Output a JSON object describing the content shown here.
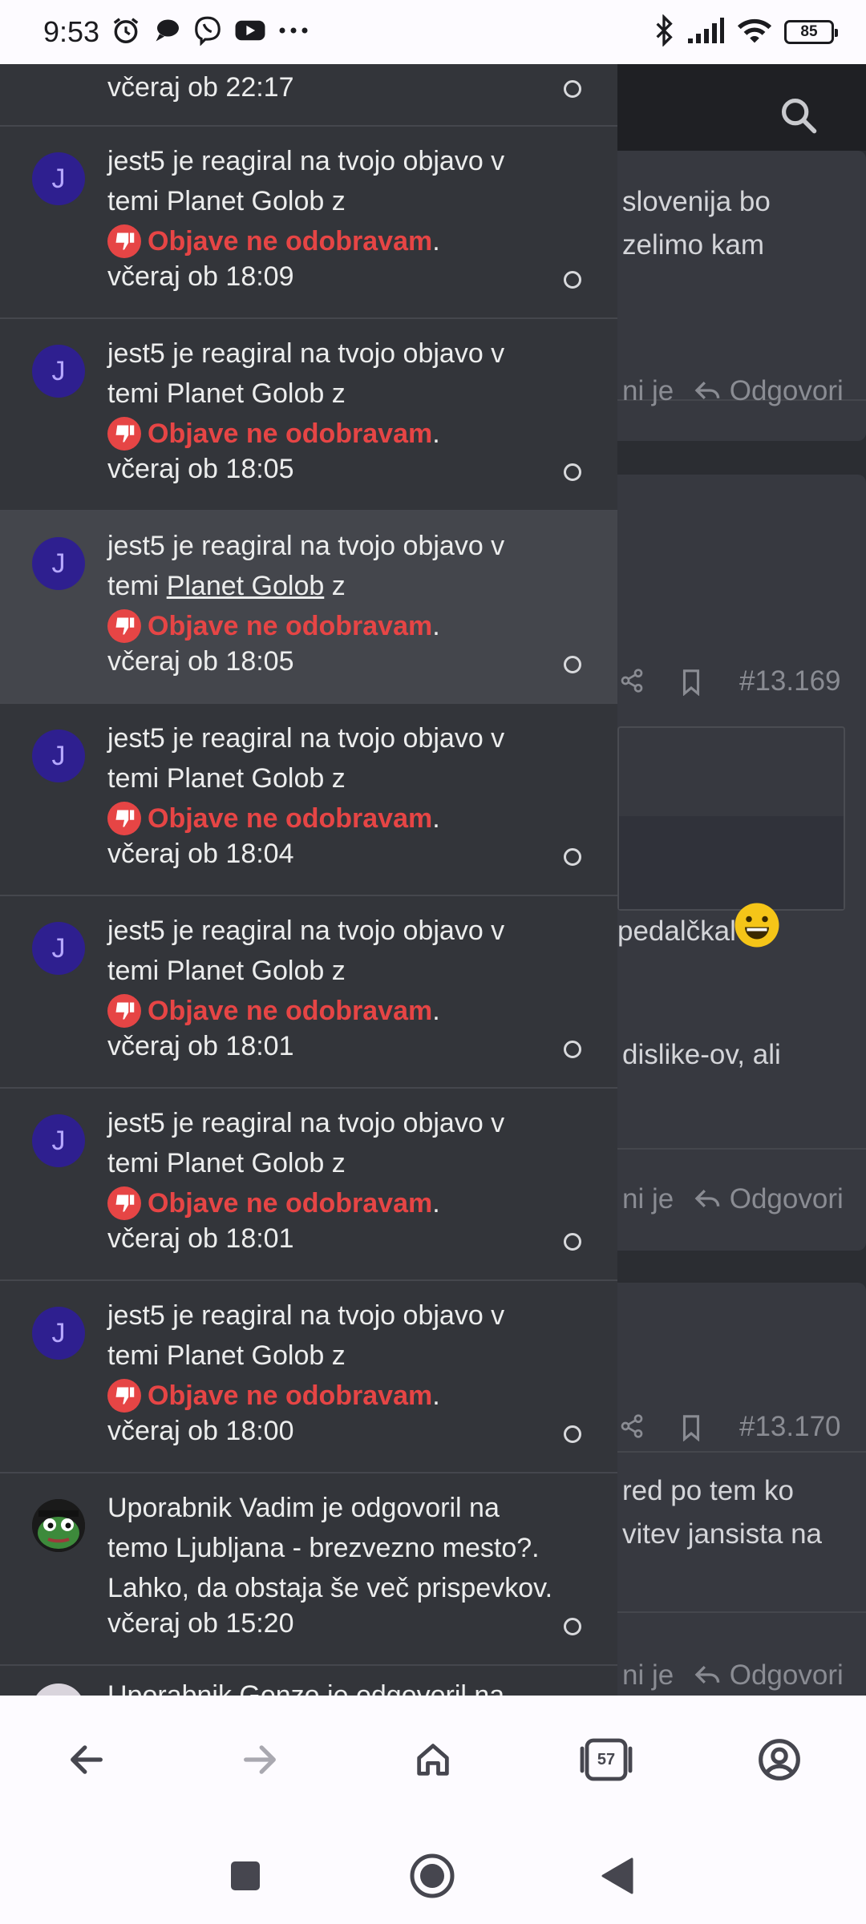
{
  "status_bar": {
    "time": "9:53",
    "battery": "85",
    "icons": [
      "alarm-icon",
      "chat-icon",
      "viber-icon",
      "youtube-icon",
      "more-icon",
      "bluetooth-icon",
      "signal-icon",
      "wifi-icon",
      "battery-icon"
    ]
  },
  "background_page": {
    "snippet_1": [
      "slovenija bo",
      "zelimo kam"
    ],
    "like_partial": "ni je",
    "reply_label": "Odgovori",
    "post_number_1": "#13.169",
    "quote_partial": "pedalčkal",
    "text_partial_2": "dislike-ov, ali",
    "post_number_2": "#13.170",
    "snippet_3": [
      "red po tem ko",
      "vitev jansista na"
    ]
  },
  "notifications": [
    {
      "time": "včeraj ob 22:17"
    },
    {
      "avatar": "J",
      "line1": "jest5 je reagiral na tvojo objavo v",
      "line2_prefix": "temi ",
      "thread": "Planet Golob",
      "line2_suffix": " z",
      "reaction": "Objave ne odobravam",
      "period": ".",
      "time": "včeraj ob 18:09"
    },
    {
      "avatar": "J",
      "line1": "jest5 je reagiral na tvojo objavo v",
      "line2_prefix": "temi ",
      "thread": "Planet Golob",
      "line2_suffix": " z",
      "reaction": "Objave ne odobravam",
      "period": ".",
      "time": "včeraj ob 18:05"
    },
    {
      "avatar": "J",
      "line1": "jest5 je reagiral na tvojo objavo v",
      "line2_prefix": "temi ",
      "thread": "Planet Golob",
      "line2_suffix": " z",
      "reaction": "Objave ne odobravam",
      "period": ".",
      "time": "včeraj ob 18:05"
    },
    {
      "avatar": "J",
      "line1": "jest5 je reagiral na tvojo objavo v",
      "line2_prefix": "temi ",
      "thread": "Planet Golob",
      "line2_suffix": " z",
      "reaction": "Objave ne odobravam",
      "period": ".",
      "time": "včeraj ob 18:04"
    },
    {
      "avatar": "J",
      "line1": "jest5 je reagiral na tvojo objavo v",
      "line2_prefix": "temi ",
      "thread": "Planet Golob",
      "line2_suffix": " z",
      "reaction": "Objave ne odobravam",
      "period": ".",
      "time": "včeraj ob 18:01"
    },
    {
      "avatar": "J",
      "line1": "jest5 je reagiral na tvojo objavo v",
      "line2_prefix": "temi ",
      "thread": "Planet Golob",
      "line2_suffix": " z",
      "reaction": "Objave ne odobravam",
      "period": ".",
      "time": "včeraj ob 18:01"
    },
    {
      "avatar": "J",
      "line1": "jest5 je reagiral na tvojo objavo v",
      "line2_prefix": "temi ",
      "thread": "Planet Golob",
      "line2_suffix": " z",
      "reaction": "Objave ne odobravam",
      "period": ".",
      "time": "včeraj ob 18:00"
    },
    {
      "line1": "Uporabnik Vadim je odgovoril na",
      "line2": "temo Ljubljana - brezvezno mesto?.",
      "line3": "Lahko, da obstaja še več prispevkov.",
      "time": "včeraj ob 15:20"
    },
    {
      "line1": "Uporabnik Gonzo je odgovoril na"
    }
  ],
  "browser_toolbar": {
    "tab_count": "57"
  }
}
